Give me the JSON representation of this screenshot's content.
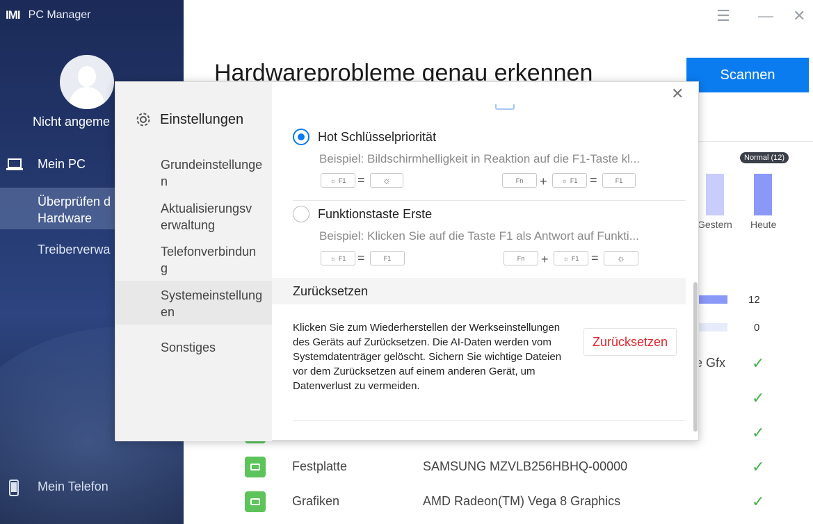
{
  "app": {
    "name": "PC Manager",
    "logo": "M"
  },
  "sidebar": {
    "user_name": "Nicht angeme",
    "items": [
      {
        "label": "Mein PC",
        "icon": "laptop-icon"
      },
      {
        "label": "Überprüfen d\nHardware",
        "icon": ""
      },
      {
        "label": "Treiberverwa",
        "icon": ""
      },
      {
        "label": "Mein Telefon",
        "icon": "phone-icon"
      }
    ]
  },
  "window_controls": {
    "menu": "☰",
    "minimize": "—",
    "close": "✕"
  },
  "main": {
    "title": "Hardwareprobleme genau erkennen",
    "scan_label": "Scannen",
    "chart": {
      "tooltip": "Normal (12)",
      "labels": [
        "Gestern",
        "Heute"
      ]
    },
    "counts": [
      "12",
      "0"
    ],
    "gfx_text": "e Gfx",
    "rows": [
      {
        "label": "Festplatte",
        "value": "SAMSUNG MZVLB256HBHQ-00000"
      },
      {
        "label": "Grafiken",
        "value": "AMD Radeon(TM) Vega 8 Graphics"
      }
    ]
  },
  "dialog": {
    "title": "Einstellungen",
    "menu": [
      "Grundeinstellunge\nn",
      "Aktualisierungsv\nerwaltung",
      "Telefonverbindun\ng",
      "Systemeinstellung\nen",
      "Sonstiges"
    ],
    "option1": {
      "title": "Hot Schlüsselpriorität",
      "desc": "Beispiel: Bildschirmhelligkeit in Reaktion auf die F1-Taste kl..."
    },
    "option2": {
      "title": "Funktionstaste Erste",
      "desc": "Beispiel: Klicken Sie auf die Taste F1 als Antwort auf Funkti..."
    },
    "keys": {
      "f1": "F1",
      "fn": "Fn",
      "sun": "☼"
    },
    "ops": {
      "eq": "=",
      "plus": "+"
    },
    "reset": {
      "heading": "Zurücksetzen",
      "text": "Klicken Sie zum Wiederherstellen der Werkseinstellungen des Geräts auf Zurücksetzen. Die AI-Daten werden vom Systemdatenträger gelöscht. Sichern Sie wichtige Dateien vor dem Zurücksetzen auf einem anderen Gerät, um Datenverlust zu vermeiden.",
      "button": "Zurücksetzen"
    },
    "close": "✕"
  },
  "colors": {
    "accent": "#0a7cf0",
    "danger": "#e0252d",
    "ok": "#43b04b"
  }
}
